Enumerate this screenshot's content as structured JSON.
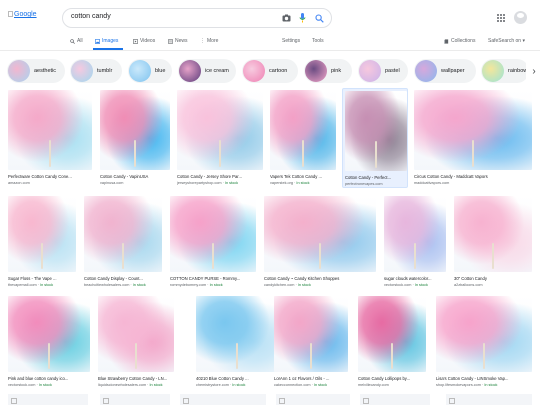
{
  "header": {
    "logo_alt": "Google",
    "search_query": "cotton candy"
  },
  "tabs": [
    {
      "label": "All"
    },
    {
      "label": "Images"
    },
    {
      "label": "Videos"
    },
    {
      "label": "News"
    },
    {
      "label": "More"
    }
  ],
  "tools": {
    "settings": "Settings",
    "tools": "Tools",
    "collections": "Collections",
    "safesearch": "SafeSearch on ▾"
  },
  "chips": [
    {
      "label": "aesthetic",
      "c1": "#f3b6cf",
      "c2": "#a8d4f0"
    },
    {
      "label": "tumblr",
      "c1": "#f6c9e0",
      "c2": "#9fd8ef"
    },
    {
      "label": "blue",
      "c1": "#cbe9fb",
      "c2": "#7ec3ef"
    },
    {
      "label": "ice cream",
      "c1": "#e7a3c9",
      "c2": "#5a3b7a"
    },
    {
      "label": "cartoon",
      "c1": "#f7cce0",
      "c2": "#ef7fb2"
    },
    {
      "label": "pink",
      "c1": "#6b4c82",
      "c2": "#f2a5c9"
    },
    {
      "label": "pastel",
      "c1": "#f7c8de",
      "c2": "#c9b3ea"
    },
    {
      "label": "wallpaper",
      "c1": "#d7a8dc",
      "c2": "#8ab8ee"
    },
    {
      "label": "rainbow",
      "c1": "#f4e69b",
      "c2": "#9be4d6"
    }
  ],
  "results": [
    {
      "caption": "Perfectware Cotton Candy Cone...",
      "source": "amazon.com",
      "in_stock": "",
      "c1": "#f5a9c9",
      "c2": "#a6dff1"
    },
    {
      "caption": "Cotton Candy - VapinUSA",
      "source": "vapinusa.com",
      "in_stock": "",
      "c1": "#f08db5",
      "c2": "#3fb4ef"
    },
    {
      "caption": "Cotton Candy - Jersey Shore Par...",
      "source": "jerseyshorepartyshop.com",
      "in_stock": "In stock",
      "c1": "#f9c2dc",
      "c2": "#8fc9e8"
    },
    {
      "caption": "Vapers Tek Cotton Candy ...",
      "source": "vaperstek.org",
      "in_stock": "In stock",
      "c1": "#f3a0c6",
      "c2": "#4cb4e9"
    },
    {
      "caption": "Cotton Candy - Perfect...",
      "source": "perfectronevapes.com",
      "in_stock": "",
      "c1": "#c68fb3",
      "c2": "#8c7f91"
    },
    {
      "caption": "Circus Cotton Candy - Maddcatt Vapors",
      "source": "maddcattvapors.com",
      "in_stock": "",
      "c1": "#f5a6cd",
      "c2": "#66b9ef"
    },
    {
      "caption": "Sugar Floss - The Vape ...",
      "source": "thevapemall.com",
      "in_stock": "In stock",
      "c1": "#f8b7cf",
      "c2": "#b7e1f3"
    },
    {
      "caption": "Cotton Candy Display - Count...",
      "source": "beachcitiewholesalers.com",
      "in_stock": "In stock",
      "c1": "#f1b3cf",
      "c2": "#a6d7ee"
    },
    {
      "caption": "COTTON CANDY PURSE - Rommy...",
      "source": "rommydebommy.com",
      "in_stock": "In stock",
      "c1": "#f6a1c9",
      "c2": "#7ad4f1"
    },
    {
      "caption": "Cotton Candy ~ Candy Kitchen Shoppes",
      "source": "candykitchen.com",
      "in_stock": "In stock",
      "c1": "#f4b0cc",
      "c2": "#8dc7ec"
    },
    {
      "caption": "sugar clouds watercolor...",
      "source": "vectorstock.com",
      "in_stock": "In stock",
      "c1": "#e7b6dd",
      "c2": "#a9bff0"
    },
    {
      "caption": "30\" Cotton Candy",
      "source": "a2zballoons.com",
      "in_stock": "",
      "c1": "#f7b2d0",
      "c2": "#f9d8e7"
    },
    {
      "caption": "Pink and blue cotton candy ico...",
      "source": "vectorstock.com",
      "in_stock": "In stock",
      "c1": "#f28cbc",
      "c2": "#63cde0"
    },
    {
      "caption": "Blue Strawberry Cotton Candy - LN...",
      "source": "liquidscionewholesalers.com",
      "in_stock": "In stock",
      "c1": "#f6b6d4",
      "c2": "#f2a4c8"
    },
    {
      "caption": "40210 Blue Cotton Candy ...",
      "source": "chemistrystore.com",
      "in_stock": "In stock",
      "c1": "#7ac7ef",
      "c2": "#b6e0f5"
    },
    {
      "caption": "LorAnn 1 oz Flavors / Oils - ...",
      "source": "cakecconnection.com",
      "in_stock": "In stock",
      "c1": "#f3a6c8",
      "c2": "#64b6ec"
    },
    {
      "caption": "Cotton Candy Lollipops by...",
      "source": "melvillecandy.com",
      "in_stock": "",
      "c1": "#e76ba3",
      "c2": "#5cc3e0"
    },
    {
      "caption": "Lisa's Cotton Candy - LINSmoke Vap...",
      "source": "shop.lifesmokevapors.com",
      "in_stock": "In stock",
      "c1": "#f7a3cb",
      "c2": "#9fd6f2"
    }
  ]
}
